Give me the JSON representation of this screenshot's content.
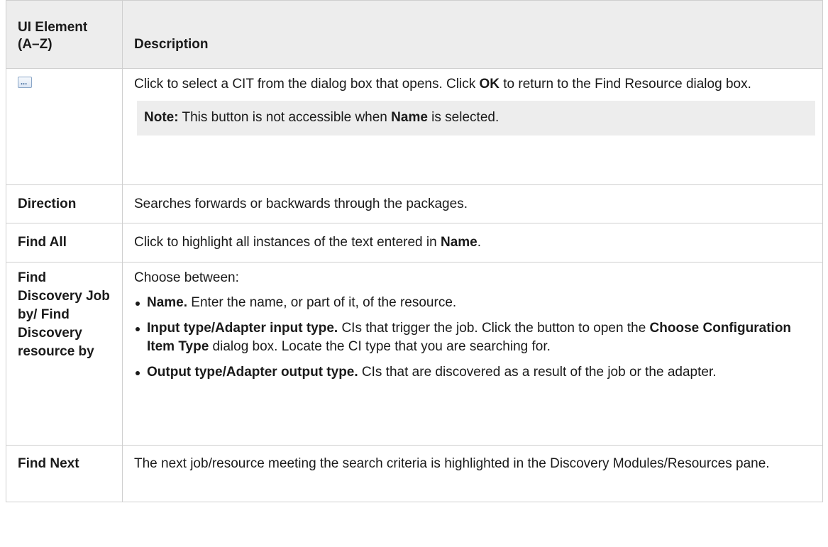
{
  "header": {
    "col1": "UI Element (A–Z)",
    "col2": "Description"
  },
  "rows": [
    {
      "element_icon": "ellipsis-button-icon",
      "desc": {
        "t1": "Click to select a CIT from the dialog box that opens. Click ",
        "b1": "OK",
        "t2": " to return to the Find Resource dialog box.",
        "note_label": "Note:",
        "note_t1": " This button is not accessible when ",
        "note_b1": "Name",
        "note_t2": " is selected."
      }
    },
    {
      "element": "Direction",
      "desc": {
        "t1": "Searches forwards or backwards through the packages."
      }
    },
    {
      "element": "Find All",
      "desc": {
        "t1": "Click to highlight all instances of the text entered in ",
        "b1": "Name",
        "t2": "."
      }
    },
    {
      "element": "Find Discovery Job by/ Find Discovery resource by",
      "desc": {
        "intro": "Choose between:",
        "items": [
          {
            "b": "Name.",
            "t": " Enter the name, or part of it, of the resource."
          },
          {
            "b": "Input type/Adapter input type.",
            "t": " CIs that trigger the job. Click the button to open the ",
            "b2": "Choose Configuration Item Type",
            "t2": " dialog box. Locate the CI type that you are searching for."
          },
          {
            "b": "Output type/Adapter output type.",
            "t": " CIs that are discovered as a result of the job or the adapter."
          }
        ]
      }
    },
    {
      "element": "Find Next",
      "desc": {
        "t1": "The next job/resource meeting the search criteria is highlighted in the Discovery Modules/Resources pane."
      }
    }
  ]
}
